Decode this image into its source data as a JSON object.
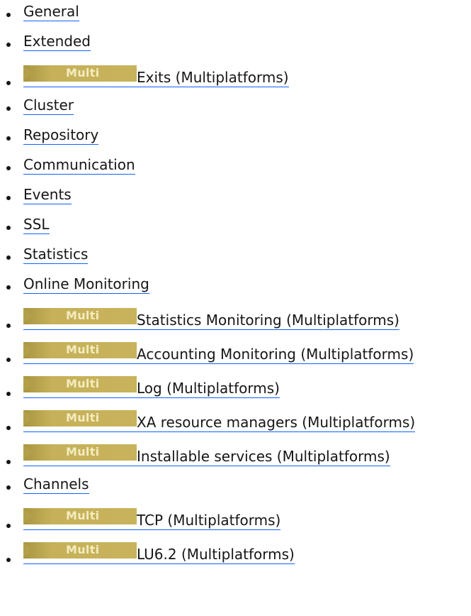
{
  "items": [
    {
      "label": "General",
      "multi": false
    },
    {
      "label": "Extended",
      "multi": false
    },
    {
      "label": "Exits (Multiplatforms)",
      "multi": true
    },
    {
      "label": "Cluster",
      "multi": false
    },
    {
      "label": "Repository",
      "multi": false
    },
    {
      "label": "Communication",
      "multi": false
    },
    {
      "label": "Events",
      "multi": false
    },
    {
      "label": "SSL",
      "multi": false
    },
    {
      "label": "Statistics",
      "multi": false
    },
    {
      "label": "Online Monitoring",
      "multi": false
    },
    {
      "label": "Statistics Monitoring (Multiplatforms)",
      "multi": true
    },
    {
      "label": "Accounting Monitoring (Multiplatforms)",
      "multi": true
    },
    {
      "label": "Log (Multiplatforms)",
      "multi": true
    },
    {
      "label": "XA resource managers (Multiplatforms)",
      "multi": true
    },
    {
      "label": "Installable services (Multiplatforms)",
      "multi": true
    },
    {
      "label": "Channels",
      "multi": false
    },
    {
      "label": "TCP (Multiplatforms)",
      "multi": true
    },
    {
      "label": "LU6.2 (Multiplatforms)",
      "multi": true
    }
  ],
  "badge": {
    "text": "Multi"
  },
  "colors": {
    "text": "#161616",
    "link_underline": "#0f62fe",
    "badge_background": "#c8b35c",
    "badge_text": "#f4ecc0"
  }
}
